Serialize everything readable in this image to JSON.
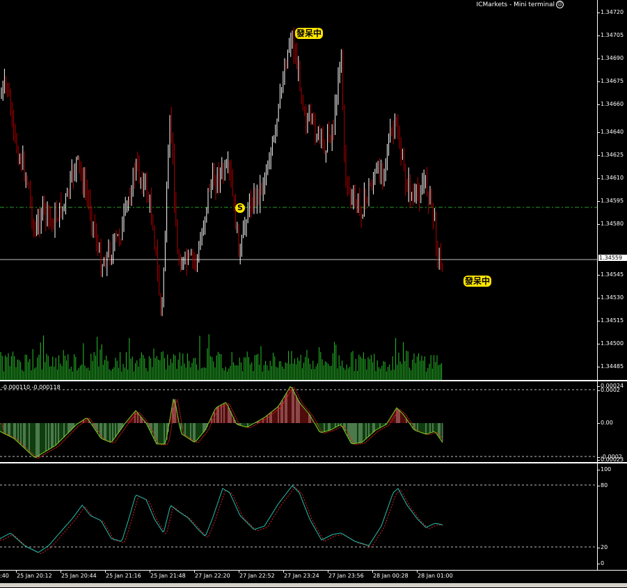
{
  "terminal_title": "ICMarkets - Mini terminal",
  "smiley_icon": "smiley-icon",
  "main_price_scale": [
    "1.34720",
    "1.34705",
    "1.34690",
    "1.34675",
    "1.34660",
    "1.34640",
    "1.34625",
    "1.34610",
    "1.34595",
    "1.34580",
    "1.34545",
    "1.34530",
    "1.34515",
    "1.34500",
    "1.34485"
  ],
  "current_price": "1.34559",
  "badge_top": "發呆中",
  "badge_right": "發呆中",
  "signal_label": "S",
  "macd": {
    "label": "-0.000110 -0.000118",
    "scale_top": "0.00024",
    "scale_mid": "0.0002",
    "scale_zero": "0.00",
    "scale_low": "-0.0002",
    "scale_bottom": "0.00023"
  },
  "stoch": {
    "scale": [
      "100",
      "80",
      "20",
      "0"
    ]
  },
  "time_axis": [
    ":40",
    "25 Jan 20:12",
    "25 Jan 20:44",
    "25 Jan 21:16",
    "25 Jan 21:48",
    "27 Jan 22:20",
    "27 Jan 22:52",
    "27 Jan 23:24",
    "27 Jan 23:56",
    "28 Jan 00:28",
    "28 Jan 01:00"
  ],
  "colors": {
    "up_candle": "#ffffff",
    "down_candle": "#b00000",
    "volume": "#29c42a",
    "macd_pos": "#a01818",
    "macd_neg": "#1e7a1e",
    "dash_line": "#25a025",
    "stoch_main": "#22c0b0",
    "stoch_signal": "#e02020",
    "badge": "#ffe600"
  }
}
